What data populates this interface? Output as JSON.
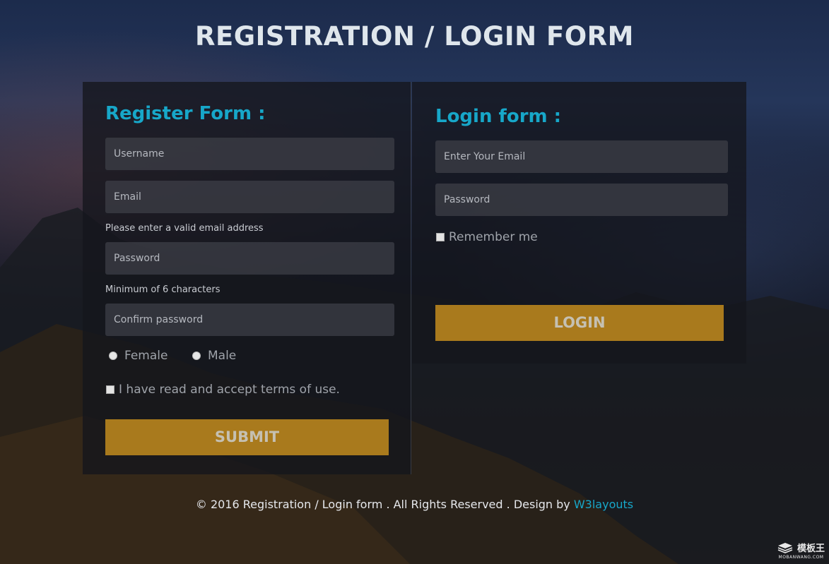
{
  "page": {
    "title": "REGISTRATION / LOGIN FORM"
  },
  "register": {
    "heading": "Register Form :",
    "username_placeholder": "Username",
    "email_placeholder": "Email",
    "email_hint": "Please enter a valid email address",
    "password_placeholder": "Password",
    "password_hint": "Minimum of 6 characters",
    "confirm_placeholder": "Confirm password",
    "gender_options": [
      "Female",
      "Male"
    ],
    "terms_label": "I have read and accept terms of use.",
    "submit_label": "SUBMIT"
  },
  "login": {
    "heading": "Login form :",
    "email_placeholder": "Enter Your Email",
    "password_placeholder": "Password",
    "remember_label": "Remember me",
    "login_label": "LOGIN"
  },
  "footer": {
    "text": "© 2016 Registration / Login form . All Rights Reserved . Design by",
    "link": "W3layouts"
  },
  "watermark": {
    "brand": "模板王",
    "url": "MOBANWANG.COM"
  },
  "colors": {
    "accent": "#17a7c9",
    "button": "#a97a1d"
  }
}
